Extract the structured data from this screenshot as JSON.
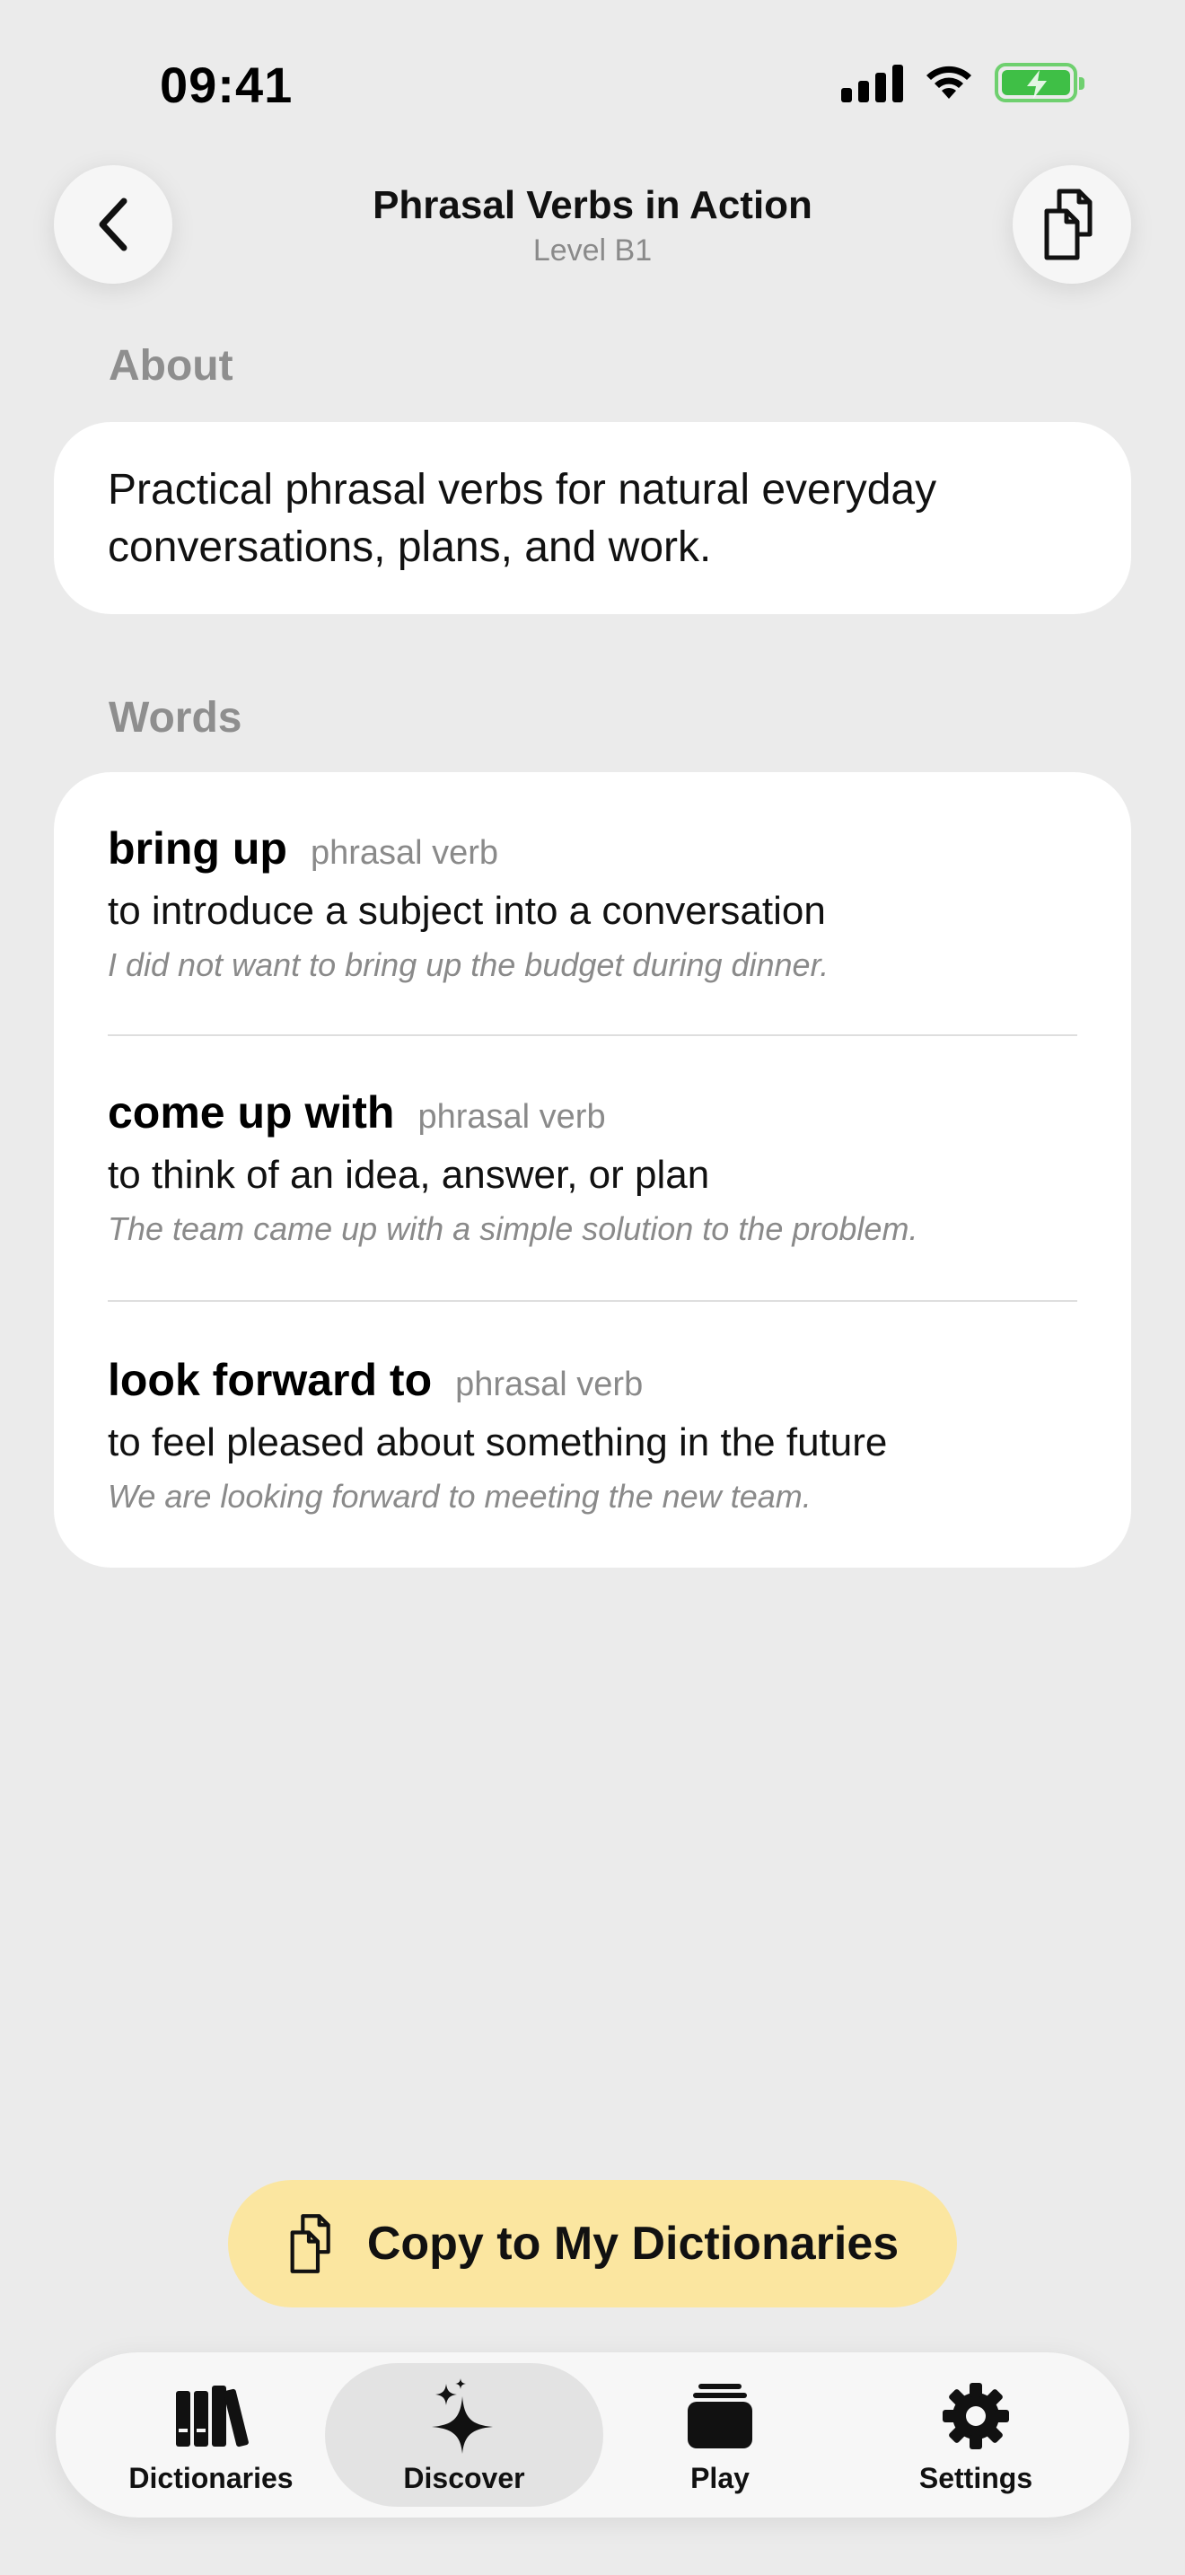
{
  "status_bar": {
    "time": "09:41"
  },
  "header": {
    "title": "Phrasal Verbs in Action",
    "subtitle": "Level B1",
    "back_icon": "chevron-left-icon",
    "copy_icon": "copy-documents-icon"
  },
  "about": {
    "label": "About",
    "text": "Practical phrasal verbs for natural everyday conversations, plans, and work."
  },
  "words": {
    "label": "Words",
    "items": [
      {
        "term": "bring up",
        "pos": "phrasal verb",
        "definition": "to introduce a subject into a conversation",
        "example": "I did not want to bring up the budget during dinner."
      },
      {
        "term": "come up with",
        "pos": "phrasal verb",
        "definition": "to think of an idea, answer, or plan",
        "example": "The team came up with a simple solution to the problem."
      },
      {
        "term": "look forward to",
        "pos": "phrasal verb",
        "definition": "to feel pleased about something in the future",
        "example": "We are looking forward to meeting the new team."
      }
    ]
  },
  "cta": {
    "label": "Copy to My Dictionaries",
    "icon": "copy-documents-icon",
    "color": "#fbe6a0"
  },
  "tabbar": {
    "tabs": [
      {
        "label": "Dictionaries",
        "icon": "books-icon"
      },
      {
        "label": "Discover",
        "icon": "sparkles-icon",
        "active": true
      },
      {
        "label": "Play",
        "icon": "cards-stack-icon"
      },
      {
        "label": "Settings",
        "icon": "gear-icon"
      }
    ]
  }
}
